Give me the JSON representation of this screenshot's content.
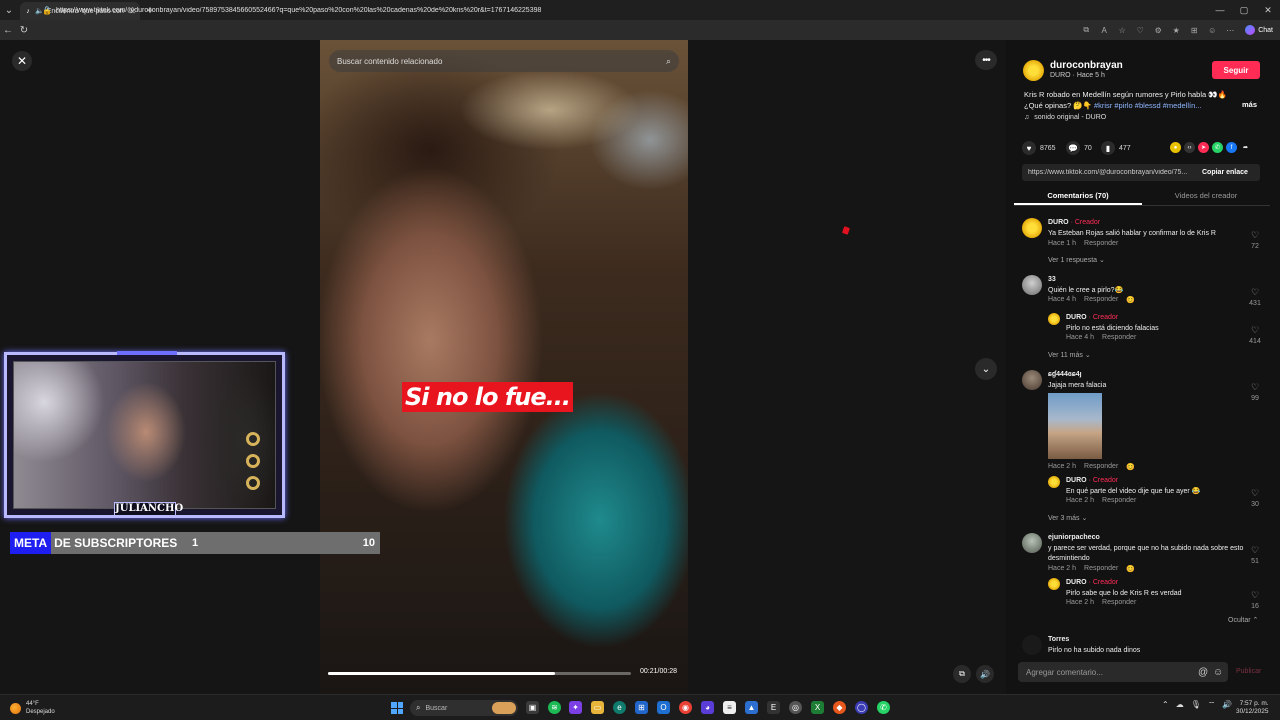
{
  "browser": {
    "tab_title": "Encuentra 'que paso con las c",
    "url": "https://www.tiktok.com/@duroconbrayan/video/7589753845660552466?q=que%20paso%20con%20las%20cadenas%20de%20kris%20r&t=1767146225398",
    "chat_label": "Chat"
  },
  "video": {
    "search_placeholder": "Buscar contenido relacionado",
    "caption": "Si no lo fue...",
    "time": "00:21/00:28",
    "progress": 0.75
  },
  "stream_overlay": {
    "streamer_name": "JULIANCHO",
    "goal_label_1": "META",
    "goal_label_2": "DE SUBSCRIPTORES",
    "goal_current": "1",
    "goal_target": "10"
  },
  "post": {
    "author": "duroconbrayan",
    "author_sub": "DURO · Hace 5 h",
    "follow_label": "Seguir",
    "description_line1": "Kris R robado en Medellín según rumores y Pirlo habla 👀🔥",
    "description_line2_prefix": "¿Qué opinas? 🤔👇",
    "hashtags": "#krisr #pirlo #blessd #medellín...",
    "more_label": "más",
    "sound": "sonido original - DURO",
    "likes": "8765",
    "comments": "70",
    "saves": "477",
    "link": "https://www.tiktok.com/@duroconbrayan/video/75...",
    "copy_link_label": "Copiar enlace"
  },
  "tabs": {
    "comments": "Comentarios (70)",
    "creator_videos": "Videos del creador"
  },
  "comments": [
    {
      "name": "DURO",
      "tag": " · Creador",
      "text": "Ya Esteban Rojas salió hablar y confirmar lo de Kris R",
      "time": "Hace 1 h",
      "reply": "Responder",
      "likes": "72"
    },
    {
      "more": "Ver 1 respuesta ⌄"
    },
    {
      "name": "33",
      "text": "Quién le cree a pirlo?😂",
      "time": "Hace 4 h",
      "reply": "Responder",
      "likes": "431"
    },
    {
      "name": "DURO",
      "tag": " · Creador",
      "text": "Pirlo no está diciendo falacias",
      "time": "Hace 4 h",
      "reply": "Responder",
      "likes": "414"
    },
    {
      "more": "Ver 11 más ⌄"
    },
    {
      "name": "ɕɠ444ɞɕ4ȷ",
      "text": "Jajaja mera falacia",
      "time": "Hace 2 h",
      "reply": "Responder",
      "likes": "99"
    },
    {
      "name": "DURO",
      "tag": " · Creador",
      "text": "En qué parte del video dije que fue ayer 😂",
      "time": "Hace 2 h",
      "reply": "Responder",
      "likes": "30"
    },
    {
      "more": "Ver 3 más ⌄"
    },
    {
      "name": "ejuniorpacheco",
      "text": "y parece ser verdad, porque que no ha subido nada sobre esto desmintiendo",
      "time": "Hace 2 h",
      "reply": "Responder",
      "likes": "51"
    },
    {
      "name": "DURO",
      "tag": " · Creador",
      "text": "Pirlo sabe que lo de Kris R es verdad",
      "time": "Hace 2 h",
      "reply": "Responder",
      "likes": "16"
    },
    {
      "more": "Ocultar ⌃"
    },
    {
      "name": "Torres",
      "text": "Pirlo no ha subido nada dinos"
    }
  ],
  "comment_input": {
    "placeholder": "Agregar comentario...",
    "publish_label": "Publicar"
  },
  "taskbar": {
    "temp": "44°F",
    "weather": "Despejado",
    "search_placeholder": "Buscar",
    "time": "7:57 p. m.",
    "date": "30/12/2025"
  }
}
